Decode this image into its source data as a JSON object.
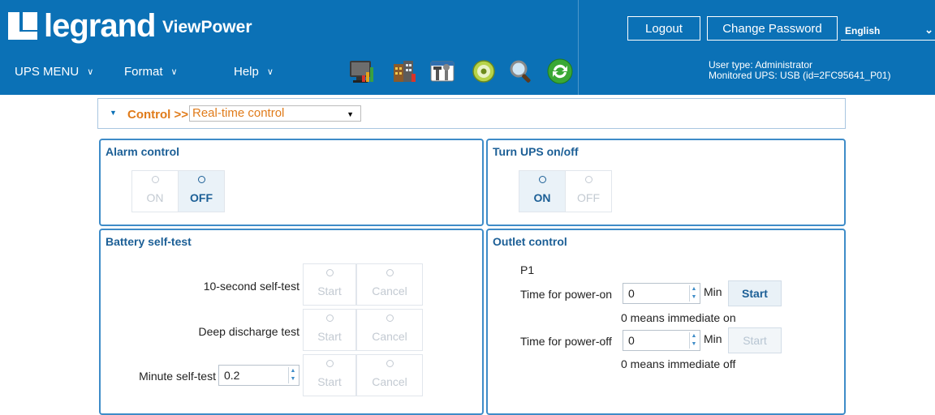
{
  "header": {
    "logo_text": "legrand",
    "app_name": "ViewPower",
    "logout_label": "Logout",
    "change_password_label": "Change Password",
    "language": "English",
    "menus": [
      {
        "label": "UPS MENU"
      },
      {
        "label": "Format"
      },
      {
        "label": "Help"
      }
    ],
    "toolbar_icons": [
      "monitor-chart-icon",
      "building-chart-icon",
      "tools-icon",
      "disc-icon",
      "magnifier-icon",
      "refresh-icon"
    ],
    "user_type": "User type: Administrator",
    "monitored_ups": "Monitored UPS: USB (id=2FC95641_P01)",
    "colors": {
      "header_bg": "#0b71b6",
      "accent_orange": "#e07b1a",
      "panel_border": "#3e8cc8"
    }
  },
  "control_bar": {
    "label": "Control >>",
    "selected_view": "Real-time control"
  },
  "alarm_control": {
    "title": "Alarm control",
    "on_label": "ON",
    "off_label": "OFF",
    "selected": "OFF"
  },
  "turn_ups": {
    "title": "Turn UPS on/off",
    "on_label": "ON",
    "off_label": "OFF",
    "selected": "ON"
  },
  "battery_self_test": {
    "title": "Battery self-test",
    "start_label": "Start",
    "cancel_label": "Cancel",
    "tests": [
      {
        "label": "10-second self-test"
      },
      {
        "label": "Deep discharge test"
      },
      {
        "label": "Minute self-test",
        "value": "0.2"
      }
    ]
  },
  "outlet_control": {
    "title": "Outlet control",
    "outlet_name": "P1",
    "power_on_label": "Time for power-on",
    "power_on_value": "0",
    "power_off_label": "Time for power-off",
    "power_off_value": "0",
    "unit": "Min",
    "start_label": "Start",
    "power_on_note": "0 means immediate on",
    "power_off_note": "0 means immediate off"
  }
}
